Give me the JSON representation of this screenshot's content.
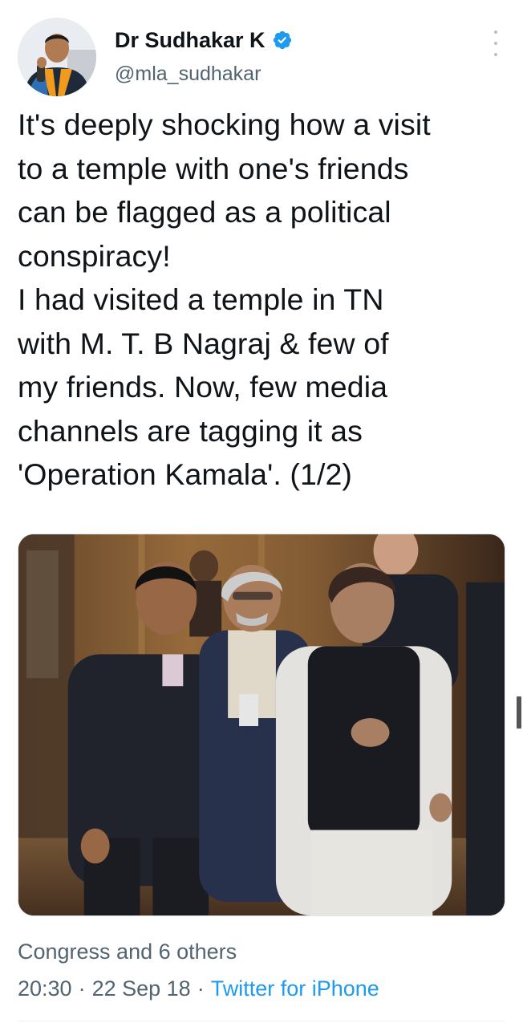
{
  "tweet": {
    "author": {
      "display_name": "Dr Sudhakar K",
      "handle": "@mla_sudhakar",
      "verified": true,
      "avatar_icon": "profile-photo"
    },
    "more_icon": "more-vertical-icon",
    "text_lines": [
      "It's deeply shocking how a visit",
      "to a temple with one's friends",
      "can be flagged as a political",
      "conspiracy!",
      "I had visited a temple in TN",
      "with M. T. B Nagraj & few of",
      "my friends. Now, few media",
      "channels are tagging it as",
      "'Operation Kamala'. (1/2)"
    ],
    "media": {
      "type": "photo"
    },
    "liked_by": "Congress and 6 others",
    "time": "20:30",
    "date": "22 Sep 18",
    "separator": "·",
    "source": "Twitter for iPhone"
  },
  "colors": {
    "text_primary": "#0f1419",
    "text_secondary": "#536471",
    "link": "#1d9bf0",
    "verified": "#1d9bf0"
  }
}
